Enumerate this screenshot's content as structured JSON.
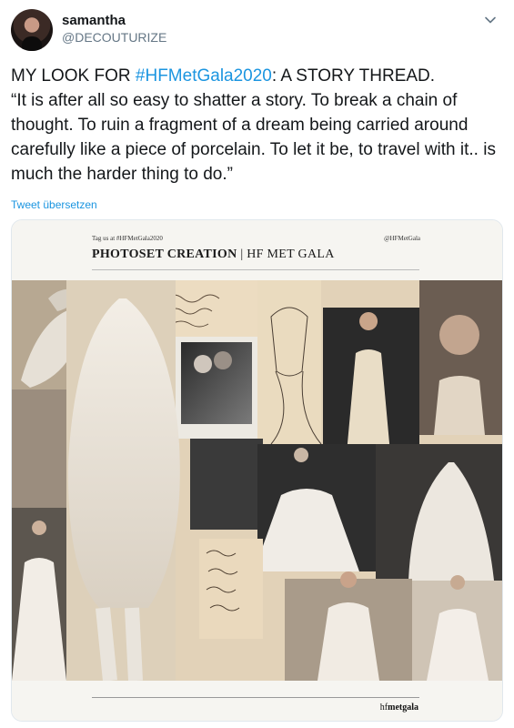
{
  "author": {
    "name": "samantha",
    "handle": "@DECOUTURIZE"
  },
  "tweet": {
    "prefix": "MY LOOK FOR ",
    "hashtag": "#HFMetGala2020",
    "suffix": ": A STORY THREAD.",
    "quote": "“It is after all so easy to shatter a story. To break a chain of thought. To ruin a fragment of a dream being carried around carefully like a piece of porcelain. To let it be, to travel with it.. is much the harder thing to do.”",
    "translate": "Tweet übersetzen"
  },
  "image": {
    "tag_left": "Tag us at #HFMetGala2020",
    "tag_right": "@HFMetGala",
    "title_bold": "PHOTOSET CREATION",
    "title_rest": " | HF MET GALA",
    "footer_logo_plain": "hf",
    "footer_logo_bold": "metgala"
  },
  "icons": {
    "menu": "chevron-down-icon"
  }
}
